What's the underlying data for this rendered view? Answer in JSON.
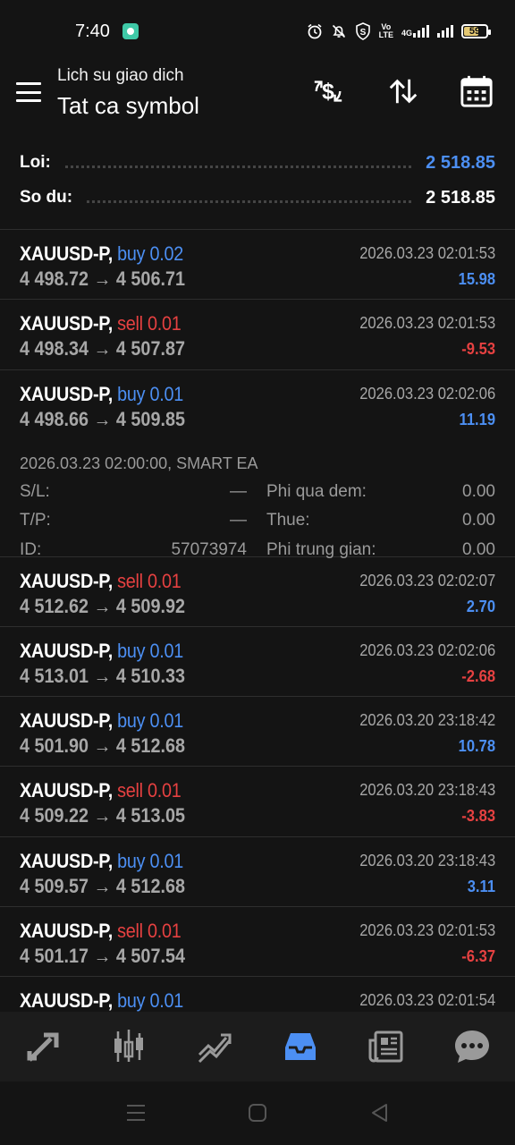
{
  "status_bar": {
    "time": "7:40",
    "net_label_top": "Vo",
    "net_label_bottom": "LTE",
    "cell_label": "4G",
    "battery": "59"
  },
  "header": {
    "subtitle": "Lich su giao dich",
    "title": "Tat ca symbol",
    "icons": [
      "dollar-refresh-icon",
      "sort-icon",
      "calendar-icon"
    ]
  },
  "summary": {
    "profit_label": "Loi:",
    "profit_value": "2 518.85",
    "balance_label": "So du:",
    "balance_value": "2 518.85"
  },
  "trades": [
    {
      "symbol": "XAUUSD-P,",
      "side": "buy",
      "volume": "0.02",
      "open": "4 498.72",
      "close": "4 506.71",
      "time": "2026.03.23 02:01:53",
      "profit": "15.98"
    },
    {
      "symbol": "XAUUSD-P,",
      "side": "sell",
      "volume": "0.01",
      "open": "4 498.34",
      "close": "4 507.87",
      "time": "2026.03.23 02:01:53",
      "profit": "-9.53"
    },
    {
      "symbol": "XAUUSD-P,",
      "side": "buy",
      "volume": "0.01",
      "open": "4 498.66",
      "close": "4 509.85",
      "time": "2026.03.23 02:02:06",
      "profit": "11.19",
      "detail": {
        "comment": "2026.03.23 02:00:00, SMART EA",
        "sl_label": "S/L:",
        "sl_value": "—",
        "tp_label": "T/P:",
        "tp_value": "—",
        "id_label": "ID:",
        "id_value": "57073974",
        "swap_label": "Phi qua dem:",
        "swap_value": "0.00",
        "tax_label": "Thue:",
        "tax_value": "0.00",
        "commission_label": "Phi trung gian:",
        "commission_value": "0.00"
      }
    },
    {
      "symbol": "XAUUSD-P,",
      "side": "sell",
      "volume": "0.01",
      "open": "4 512.62",
      "close": "4 509.92",
      "time": "2026.03.23 02:02:07",
      "profit": "2.70"
    },
    {
      "symbol": "XAUUSD-P,",
      "side": "buy",
      "volume": "0.01",
      "open": "4 513.01",
      "close": "4 510.33",
      "time": "2026.03.23 02:02:06",
      "profit": "-2.68"
    },
    {
      "symbol": "XAUUSD-P,",
      "side": "buy",
      "volume": "0.01",
      "open": "4 501.90",
      "close": "4 512.68",
      "time": "2026.03.20 23:18:42",
      "profit": "10.78"
    },
    {
      "symbol": "XAUUSD-P,",
      "side": "sell",
      "volume": "0.01",
      "open": "4 509.22",
      "close": "4 513.05",
      "time": "2026.03.20 23:18:43",
      "profit": "-3.83"
    },
    {
      "symbol": "XAUUSD-P,",
      "side": "buy",
      "volume": "0.01",
      "open": "4 509.57",
      "close": "4 512.68",
      "time": "2026.03.20 23:18:43",
      "profit": "3.11"
    },
    {
      "symbol": "XAUUSD-P,",
      "side": "sell",
      "volume": "0.01",
      "open": "4 501.17",
      "close": "4 507.54",
      "time": "2026.03.23 02:01:53",
      "profit": "-6.37"
    },
    {
      "symbol": "XAUUSD-P,",
      "side": "buy",
      "volume": "0.01",
      "open": "",
      "close": "",
      "time": "2026.03.23 02:01:54",
      "profit": ""
    }
  ],
  "arrow": "→",
  "bottom_nav": [
    {
      "name": "quotes-icon",
      "active": false
    },
    {
      "name": "chart-icon",
      "active": false
    },
    {
      "name": "trade-icon",
      "active": false
    },
    {
      "name": "history-icon",
      "active": true
    },
    {
      "name": "news-icon",
      "active": false
    },
    {
      "name": "chat-icon",
      "active": false
    }
  ],
  "colors": {
    "background": "#141414",
    "buy": "#4c8ff3",
    "sell": "#e64141",
    "muted": "#a7a7a7",
    "active_nav": "#4c8ff3",
    "nav_icon": "#9a9a9a"
  }
}
